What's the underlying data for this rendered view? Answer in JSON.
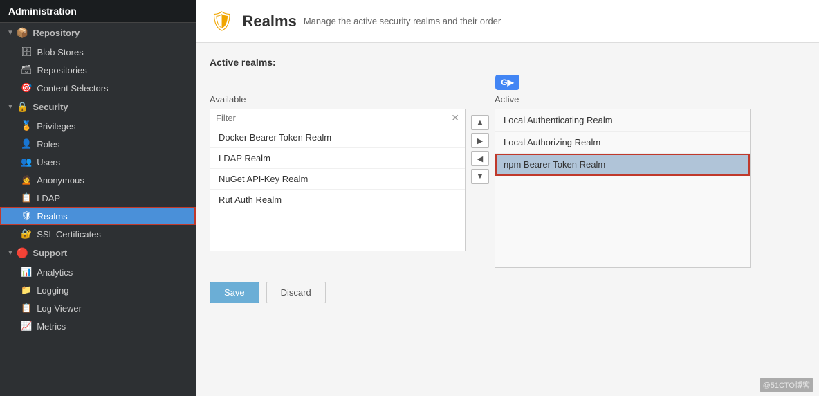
{
  "app": {
    "title": "Administration"
  },
  "sidebar": {
    "repository_section": "Repository",
    "items_repository": [
      {
        "id": "blob-stores",
        "label": "Blob Stores",
        "icon": "🗄"
      },
      {
        "id": "repositories",
        "label": "Repositories",
        "icon": "🗃"
      },
      {
        "id": "content-selectors",
        "label": "Content Selectors",
        "icon": "🎯"
      }
    ],
    "security_section": "Security",
    "items_security": [
      {
        "id": "privileges",
        "label": "Privileges",
        "icon": "🏅"
      },
      {
        "id": "roles",
        "label": "Roles",
        "icon": "👤"
      },
      {
        "id": "users",
        "label": "Users",
        "icon": "👥"
      },
      {
        "id": "anonymous",
        "label": "Anonymous",
        "icon": "🙍"
      },
      {
        "id": "ldap",
        "label": "LDAP",
        "icon": "📋"
      },
      {
        "id": "realms",
        "label": "Realms",
        "icon": "🛡",
        "active": true
      },
      {
        "id": "ssl-certificates",
        "label": "SSL Certificates",
        "icon": "🔐"
      }
    ],
    "support_section": "Support",
    "items_support": [
      {
        "id": "analytics",
        "label": "Analytics",
        "icon": "📊"
      },
      {
        "id": "logging",
        "label": "Logging",
        "icon": "📁"
      },
      {
        "id": "log-viewer",
        "label": "Log Viewer",
        "icon": "📋"
      },
      {
        "id": "metrics",
        "label": "Metrics",
        "icon": "📈"
      }
    ]
  },
  "page": {
    "icon": "🛡",
    "title": "Realms",
    "subtitle": "Manage the active security realms and their order"
  },
  "realms": {
    "active_realms_label": "Active realms:",
    "available_label": "Available",
    "active_label": "Active",
    "filter_placeholder": "Filter",
    "available_items": [
      {
        "id": "docker-bearer",
        "label": "Docker Bearer Token Realm"
      },
      {
        "id": "ldap-realm",
        "label": "LDAP Realm"
      },
      {
        "id": "nuget-realm",
        "label": "NuGet API-Key Realm"
      },
      {
        "id": "rut-auth",
        "label": "Rut Auth Realm"
      }
    ],
    "active_items": [
      {
        "id": "local-auth",
        "label": "Local Authenticating Realm"
      },
      {
        "id": "local-authz",
        "label": "Local Authorizing Realm"
      },
      {
        "id": "npm-bearer",
        "label": "npm Bearer Token Realm",
        "selected": true
      }
    ],
    "buttons": {
      "save": "Save",
      "discard": "Discard"
    },
    "arrows": {
      "up": "▲",
      "right": "▶",
      "left": "◀",
      "down": "▼"
    }
  },
  "watermark": "@51CTO博客"
}
